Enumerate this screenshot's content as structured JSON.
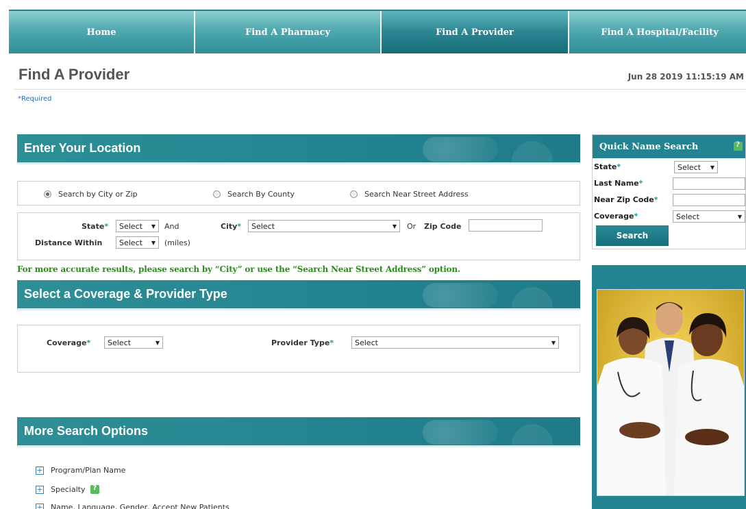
{
  "nav": {
    "tabs": [
      {
        "label": "Home",
        "active": false
      },
      {
        "label": "Find A Pharmacy",
        "active": false
      },
      {
        "label": "Find A Provider",
        "active": true
      },
      {
        "label": "Find A Hospital/Facility",
        "active": false
      }
    ]
  },
  "page": {
    "title": "Find A Provider",
    "timestamp": "Jun 28 2019 11:15:19 AM",
    "required_note": "*Required"
  },
  "location": {
    "header": "Enter Your Location",
    "radios": [
      {
        "label": "Search by City or Zip",
        "selected": true
      },
      {
        "label": "Search By County",
        "selected": false
      },
      {
        "label": "Search Near Street Address",
        "selected": false
      }
    ],
    "state_label": "State",
    "state_value": "Select",
    "and_text": "And",
    "city_label": "City",
    "city_value": "Select",
    "or_text": "Or",
    "zip_label": "Zip Code",
    "zip_value": "",
    "distance_label": "Distance Within",
    "distance_value": "Select",
    "miles_text": "(miles)",
    "required_mark": "*"
  },
  "note": "For more accurate results, please search by “City” or use the “Search Near Street Address” option.",
  "coverage_section": {
    "header": "Select a Coverage & Provider Type",
    "coverage_label": "Coverage",
    "coverage_value": "Select",
    "provider_type_label": "Provider Type",
    "provider_type_value": "Select"
  },
  "more_options": {
    "header": "More Search Options",
    "items": [
      {
        "label": "Program/Plan Name"
      },
      {
        "label": "Specialty"
      },
      {
        "label": "Name, Language, Gender, Accept New Patients"
      }
    ]
  },
  "quick_search": {
    "header": "Quick Name Search",
    "state_label": "State",
    "state_value": "Select",
    "last_name_label": "Last Name",
    "last_name_value": "",
    "zip_label": "Near Zip Code",
    "zip_value": "",
    "coverage_label": "Coverage",
    "coverage_value": "Select",
    "search_button": "Search"
  },
  "icons": {
    "help": "help-icon",
    "expand": "plus-box-icon",
    "dropdown": "chevron-down-icon"
  },
  "colors": {
    "teal": "#238390",
    "note_green": "#2e8b1e",
    "required_blue": "#2a6db5"
  }
}
